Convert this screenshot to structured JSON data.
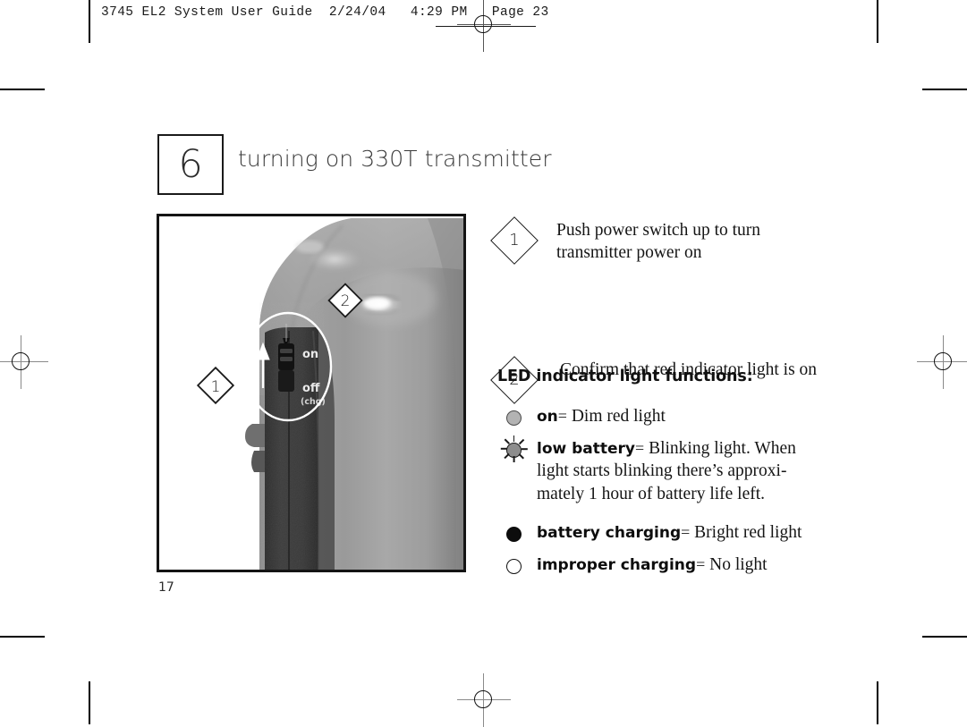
{
  "print_slug": {
    "text": "3745 EL2 System User Guide  2/24/04   4:29 PM   Page 23"
  },
  "chapter": {
    "number": "6",
    "title": "turning on 330T transmitter"
  },
  "page_number": "17",
  "photo": {
    "alt_label": "330T transmitter power switch photograph",
    "switch_labels": {
      "on": "on",
      "off": "off",
      "chg": "(chg)"
    },
    "callouts": [
      {
        "id": "1",
        "label": "1"
      },
      {
        "id": "2",
        "label": "2"
      }
    ]
  },
  "steps": [
    {
      "marker": "1",
      "text": "Push power switch up to turn transmitter power on"
    },
    {
      "marker": "2",
      "text": "Confirm that red indicator light is on"
    }
  ],
  "led_section": {
    "heading": "LED indicator light functions:",
    "items": [
      {
        "icon": "led-dim-circle-icon",
        "term": "on",
        "separator": "=",
        "description": "Dim red light"
      },
      {
        "icon": "led-blinking-sun-icon",
        "term": "low battery",
        "separator": "=",
        "description": "Blinking light. When light starts blinking there’s approxi-mately 1 hour of battery life left."
      },
      {
        "icon": "led-solid-circle-icon",
        "term": "battery charging",
        "separator": "=",
        "description": "Bright red light"
      },
      {
        "icon": "led-hollow-circle-icon",
        "term": "improper charging",
        "separator": "=",
        "description": "No light"
      }
    ]
  },
  "colors": {
    "ink": "#151515",
    "device_body": "#9a9a9a",
    "device_dark": "#3a3a3a",
    "paper": "#ffffff"
  }
}
